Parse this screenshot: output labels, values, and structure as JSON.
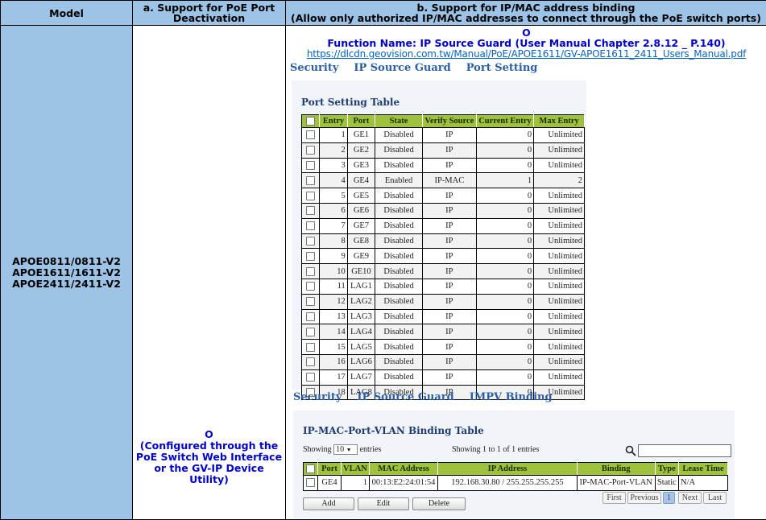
{
  "headers": {
    "model": "Model",
    "col_a": [
      "a. Support for PoE Port",
      "Deactivation"
    ],
    "col_b": [
      "b. Support for IP/MAC address binding",
      "(Allow only authorized IP/MAC addresses to connect through the PoE switch ports)"
    ]
  },
  "models": [
    "APOE0811/0811-V2",
    "APOE1611/1611-V2",
    "APOE2411/2411-V2"
  ],
  "col_a_content": [
    "O",
    "(Configured through the",
    "PoE Switch Web Interface",
    "or the GV-IP Device Utility)"
  ],
  "col_b": {
    "mark": "O",
    "function_name": "Function Name: IP Source Guard (User Manual Chapter 2.8.12 _ P.140)",
    "url": "https://dlcdn.geovision.com.tw/Manual/PoE/APOE1611/GV-APOE1611_2411_Users_Manual.pdf"
  },
  "shot1": {
    "breadcrumb": [
      "Security",
      "IP Source Guard",
      "Port Setting"
    ],
    "title": "Port Setting Table",
    "columns": [
      "Entry",
      "Port",
      "State",
      "Verify Source",
      "Current Entry",
      "Max Entry"
    ],
    "rows": [
      [
        "1",
        "GE1",
        "Disabled",
        "IP",
        "0",
        "Unlimited"
      ],
      [
        "2",
        "GE2",
        "Disabled",
        "IP",
        "0",
        "Unlimited"
      ],
      [
        "3",
        "GE3",
        "Disabled",
        "IP",
        "0",
        "Unlimited"
      ],
      [
        "4",
        "GE4",
        "Enabled",
        "IP-MAC",
        "1",
        "2"
      ],
      [
        "5",
        "GE5",
        "Disabled",
        "IP",
        "0",
        "Unlimited"
      ],
      [
        "6",
        "GE6",
        "Disabled",
        "IP",
        "0",
        "Unlimited"
      ],
      [
        "7",
        "GE7",
        "Disabled",
        "IP",
        "0",
        "Unlimited"
      ],
      [
        "8",
        "GE8",
        "Disabled",
        "IP",
        "0",
        "Unlimited"
      ],
      [
        "9",
        "GE9",
        "Disabled",
        "IP",
        "0",
        "Unlimited"
      ],
      [
        "10",
        "GE10",
        "Disabled",
        "IP",
        "0",
        "Unlimited"
      ],
      [
        "11",
        "LAG1",
        "Disabled",
        "IP",
        "0",
        "Unlimited"
      ],
      [
        "12",
        "LAG2",
        "Disabled",
        "IP",
        "0",
        "Unlimited"
      ],
      [
        "13",
        "LAG3",
        "Disabled",
        "IP",
        "0",
        "Unlimited"
      ],
      [
        "14",
        "LAG4",
        "Disabled",
        "IP",
        "0",
        "Unlimited"
      ],
      [
        "15",
        "LAG5",
        "Disabled",
        "IP",
        "0",
        "Unlimited"
      ],
      [
        "16",
        "LAG6",
        "Disabled",
        "IP",
        "0",
        "Unlimited"
      ],
      [
        "17",
        "LAG7",
        "Disabled",
        "IP",
        "0",
        "Unlimited"
      ],
      [
        "18",
        "LAG8",
        "Disabled",
        "IP",
        "0",
        "Unlimited"
      ]
    ]
  },
  "shot2": {
    "breadcrumb": [
      "Security",
      "IP Source Guard",
      "IMPV Binding"
    ],
    "title": "IP-MAC-Port-VLAN Binding Table",
    "showing_label": "Showing",
    "entries_value": "10",
    "entries_label": "entries",
    "summary": "Showing 1 to 1 of 1 entries",
    "columns": [
      "Port",
      "VLAN",
      "MAC Address",
      "IP Address",
      "Binding",
      "Type",
      "Lease Time"
    ],
    "rows": [
      [
        "GE4",
        "1",
        "00:13:E2:24:01:54",
        "192.168.30.80 / 255.255.255.255",
        "IP-MAC-Port-VLAN",
        "Static",
        "N/A"
      ]
    ],
    "buttons": [
      "Add",
      "Edit",
      "Delete"
    ],
    "pagination": [
      "First",
      "Previous",
      "1",
      "Next",
      "Last"
    ]
  },
  "colors": {
    "header_bg": "#9dc3e6",
    "blue_text": "#0000cc",
    "table_header_green": "#9ec23c",
    "breadcrumb_blue": "#2b5fa5"
  }
}
